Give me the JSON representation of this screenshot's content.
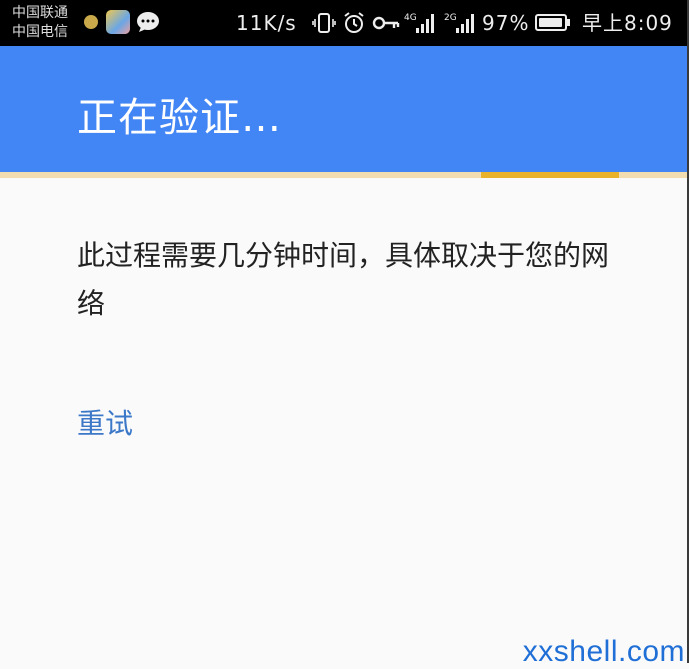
{
  "status_bar": {
    "carrier_1": "中国联通",
    "carrier_2": "中国电信",
    "net_speed": "11K/s",
    "signal_1_label": "4G",
    "signal_2_label": "2G",
    "battery_text": "97%",
    "battery_level": 0.97,
    "time": "早上8:09"
  },
  "app_bar": {
    "title": "正在验证…",
    "color": "#4285f4"
  },
  "progress": {
    "track_color": "#f1ddb0",
    "bar_color": "#e8b32a"
  },
  "content": {
    "message": "此过程需要几分钟时间，具体取决于您的网络",
    "retry_label": "重试",
    "retry_color": "#3c78c8"
  },
  "watermark": {
    "text": "xxshell.com"
  }
}
